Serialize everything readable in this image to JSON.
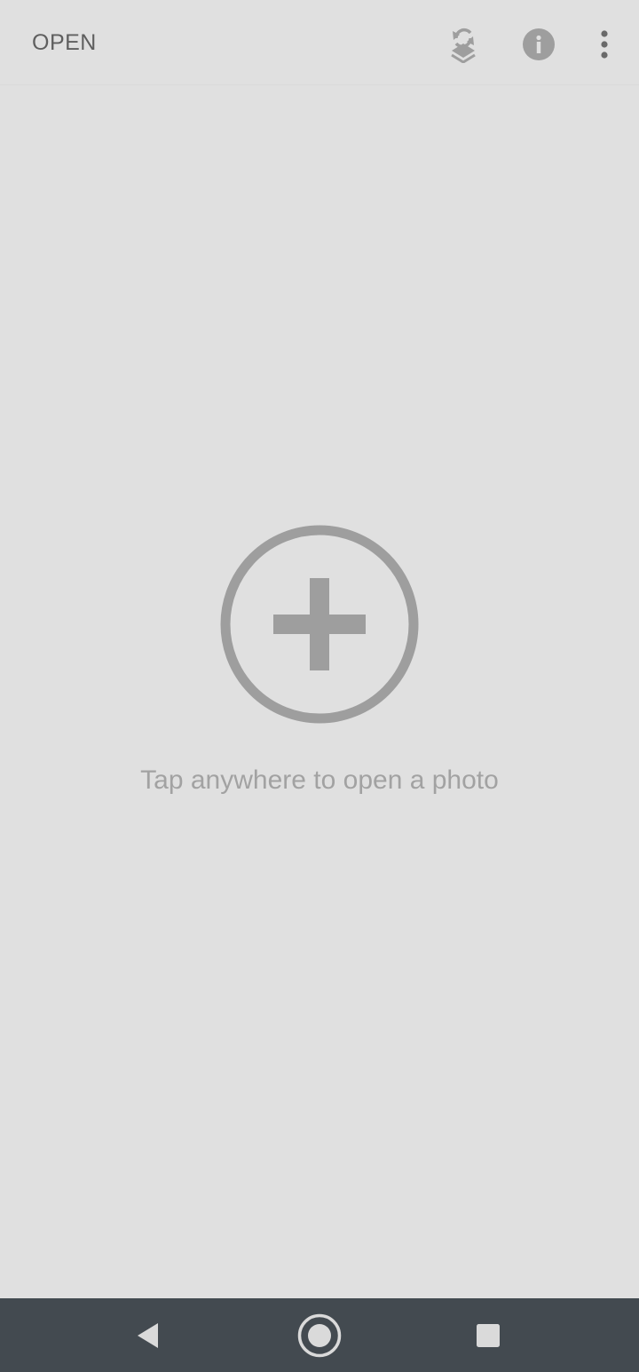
{
  "toolbar": {
    "open_label": "OPEN",
    "icons": [
      "layers-history-icon",
      "info-icon",
      "more-vert-icon"
    ]
  },
  "main": {
    "add_icon": "add-circle-icon",
    "hint_text": "Tap anywhere to open a photo"
  },
  "system_nav": {
    "buttons": [
      "back-icon",
      "home-icon",
      "recents-icon"
    ]
  },
  "colors": {
    "background": "#e0e0e0",
    "icon_gray": "#9e9e9e",
    "text_gray": "#a2a2a2",
    "nav_bar": "#434a50"
  }
}
